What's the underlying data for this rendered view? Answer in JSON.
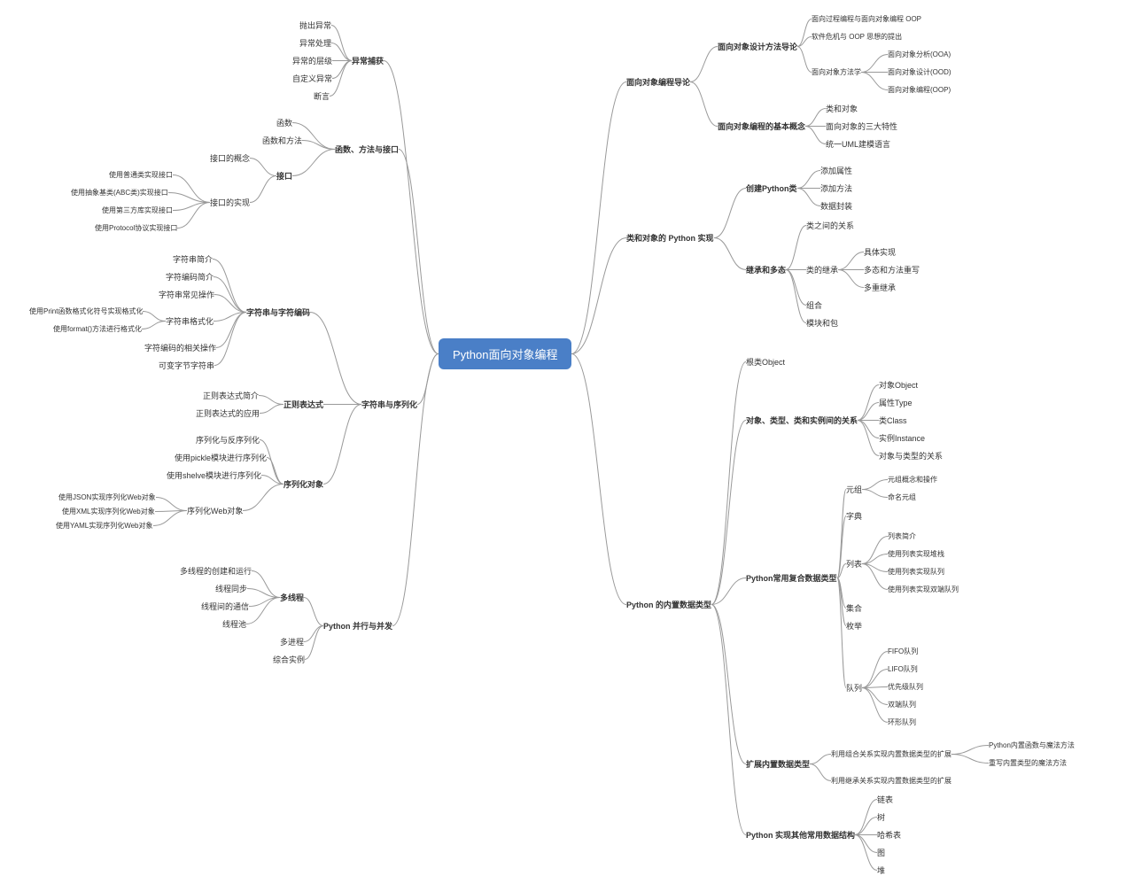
{
  "root": "Python面向对象编程",
  "left": {
    "b1": {
      "label": "异常捕获",
      "c": [
        "抛出异常",
        "异常处理",
        "异常的层级",
        "自定义异常",
        "断言"
      ]
    },
    "b2": {
      "label": "函数、方法与接口",
      "c": {
        "n0": "函数",
        "n1": "函数和方法",
        "n2": {
          "label": "接口",
          "c": {
            "n0": "接口的概念",
            "n1": {
              "label": "接口的实现",
              "c": [
                "使用普通类实现接口",
                "使用抽象基类(ABC类)实现接口",
                "使用第三方库实现接口",
                "使用Protocol协议实现接口"
              ]
            }
          }
        }
      }
    },
    "b3": {
      "label": "字符串与序列化",
      "c": {
        "n0": {
          "label": "字符串与字符编码",
          "c": {
            "n0": "字符串简介",
            "n1": "字符编码简介",
            "n2": "字符串常见操作",
            "n3": {
              "label": "字符串格式化",
              "c": [
                "使用Print函数格式化符号实现格式化",
                "使用format()方法进行格式化"
              ]
            },
            "n4": "字符编码的相关操作",
            "n5": "可变字节字符串"
          }
        },
        "n1": {
          "label": "正则表达式",
          "c": [
            "正则表达式简介",
            "正则表达式的应用"
          ]
        },
        "n2": {
          "label": "序列化对象",
          "c": {
            "n0": "序列化与反序列化",
            "n1": "使用pickle模块进行序列化",
            "n2": "使用shelve模块进行序列化",
            "n3": {
              "label": "序列化Web对象",
              "c": [
                "使用JSON实现序列化Web对象",
                "使用XML实现序列化Web对象",
                "使用YAML实现序列化Web对象"
              ]
            }
          }
        }
      }
    },
    "b4": {
      "label": "Python 并行与并发",
      "c": {
        "n0": {
          "label": "多线程",
          "c": [
            "多线程的创建和运行",
            "线程同步",
            "线程间的通信",
            "线程池"
          ]
        },
        "n1": "多进程",
        "n2": "综合实例"
      }
    }
  },
  "right": {
    "b1": {
      "label": "面向对象编程导论",
      "c": {
        "n0": {
          "label": "面向对象设计方法导论",
          "c": {
            "n0": "面向过程编程与面向对象编程 OOP",
            "n1": "软件危机与 OOP 思想的提出",
            "n2": {
              "label": "面向对象方法学",
              "c": [
                "面向对象分析(OOA)",
                "面向对象设计(OOD)",
                "面向对象编程(OOP)"
              ]
            }
          }
        },
        "n1": {
          "label": "面向对象编程的基本概念",
          "c": [
            "类和对象",
            "面向对象的三大特性",
            "统一UML建模语言"
          ]
        }
      }
    },
    "b2": {
      "label": "类和对象的 Python 实现",
      "c": {
        "n0": {
          "label": "创建Python类",
          "c": [
            "添加属性",
            "添加方法",
            "数据封装"
          ]
        },
        "n1": {
          "label": "继承和多态",
          "c": {
            "n0": "类之间的关系",
            "n1": {
              "label": "类的继承",
              "c": [
                "具体实现",
                "多态和方法重写",
                "多重继承"
              ]
            },
            "n2": "组合",
            "n3": "模块和包"
          }
        }
      }
    },
    "b3": {
      "label": "Python 的内置数据类型",
      "c": {
        "n0": "根类Object",
        "n1": {
          "label": "对象、类型、类和实例间的关系",
          "c": [
            "对象Object",
            "属性Type",
            "类Class",
            "实例Instance",
            "对象与类型的关系"
          ]
        },
        "n2": {
          "label": "Python常用复合数据类型",
          "c": {
            "n0": {
              "label": "元组",
              "c": [
                "元组概念和操作",
                "命名元组"
              ]
            },
            "n1": "字典",
            "n2": {
              "label": "列表",
              "c": [
                "列表简介",
                "使用列表实现堆栈",
                "使用列表实现队列",
                "使用列表实现双端队列"
              ]
            },
            "n3": "集合",
            "n4": "枚举",
            "n5": {
              "label": "队列",
              "c": [
                "FIFO队列",
                "LIFO队列",
                "优先级队列",
                "双端队列",
                "环形队列"
              ]
            }
          }
        },
        "n3": {
          "label": "扩展内置数据类型",
          "c": {
            "n0": {
              "label": "利用组合关系实现内置数据类型的扩展",
              "c": [
                "Python内置函数与魔法方法",
                "重写内置类型的魔法方法"
              ]
            },
            "n1": "利用继承关系实现内置数据类型的扩展"
          }
        },
        "n4": {
          "label": "Python 实现其他常用数据结构",
          "c": [
            "链表",
            "树",
            "哈希表",
            "图",
            "堆"
          ]
        }
      }
    }
  }
}
